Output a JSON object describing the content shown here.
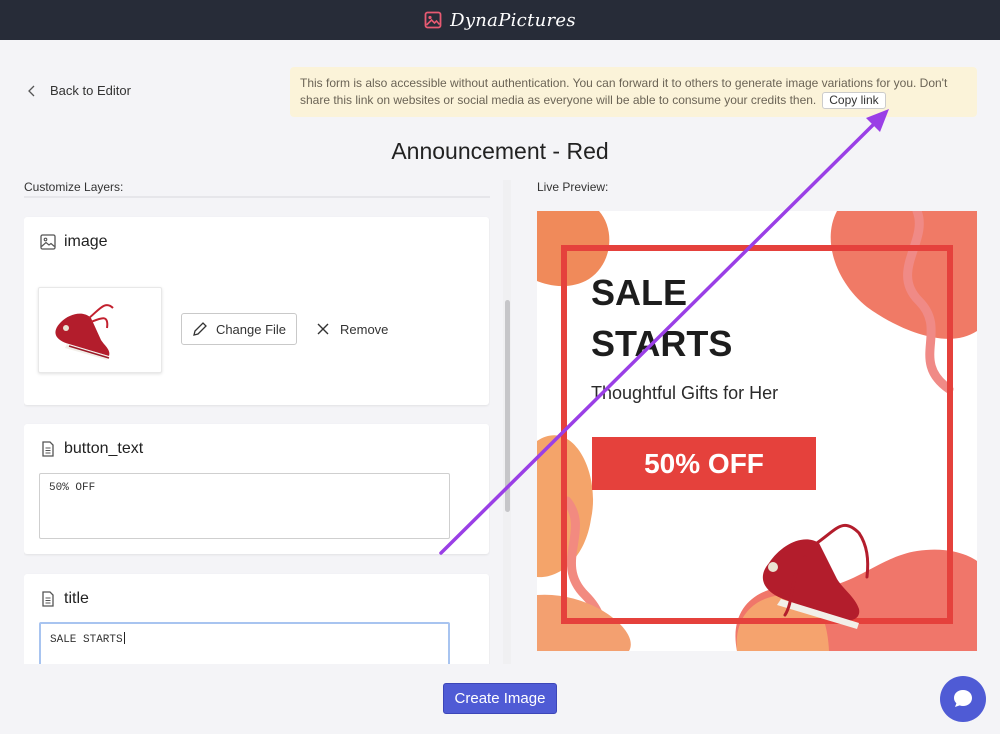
{
  "app": {
    "name": "DynaPictures"
  },
  "nav": {
    "back_label": "Back to Editor"
  },
  "notice": {
    "text": "This form is also accessible without authentication. You can forward it to others to generate image variations for you. Don't share this link on websites or social media as everyone will be able to consume your credits then.",
    "copy_label": "Copy link"
  },
  "page": {
    "title": "Announcement - Red"
  },
  "layers": {
    "heading": "Customize Layers:",
    "image": {
      "name": "image",
      "change_label": "Change File",
      "remove_label": "Remove"
    },
    "button_text": {
      "name": "button_text",
      "value": "50% OFF"
    },
    "title": {
      "name": "title",
      "value": "SALE STARTS"
    }
  },
  "preview": {
    "heading": "Live Preview:",
    "headline_line1": "SALE",
    "headline_line2": "STARTS",
    "subtitle": "Thoughtful Gifts for Her",
    "badge": "50% OFF"
  },
  "actions": {
    "create_label": "Create Image"
  },
  "colors": {
    "accent": "#4f5bd5",
    "topbar": "#272c38",
    "promo_red": "#e5413c",
    "notice_bg": "#fbf3d9",
    "annotation_arrow": "#9a3fe6"
  },
  "icons": {
    "logo": "image-icon",
    "back": "chevron-left-icon",
    "layer_image": "image-icon",
    "layer_text": "document-icon",
    "change": "pencil-icon",
    "remove": "close-icon",
    "chat": "chat-bubble-icon"
  }
}
